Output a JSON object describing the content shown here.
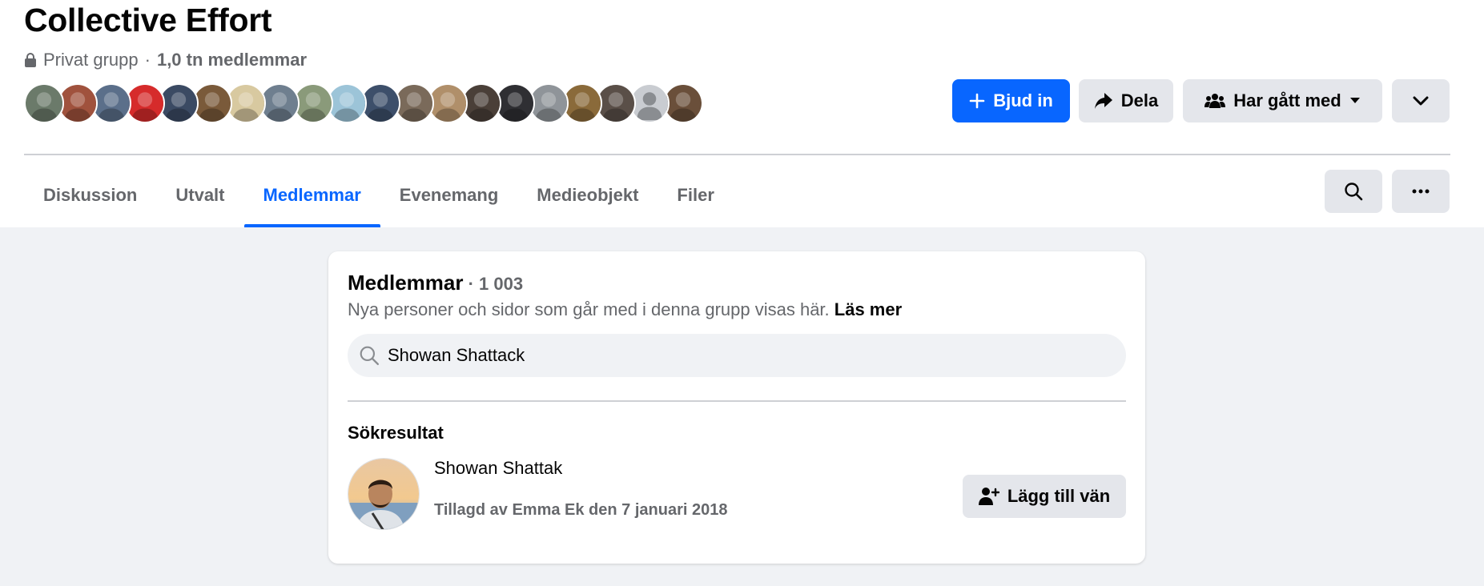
{
  "group": {
    "title": "Collective Effort",
    "privacy": "Privat grupp",
    "separator": "·",
    "members_summary": "1,0 tn medlemmar"
  },
  "avatars": [
    {
      "color": "#6b7a6a"
    },
    {
      "color": "#a0523d"
    },
    {
      "color": "#5b6f8a"
    },
    {
      "color": "#d62b2b"
    },
    {
      "color": "#3b4a63"
    },
    {
      "color": "#7a5a3a"
    },
    {
      "color": "#d8c9a0"
    },
    {
      "color": "#6f7f8f"
    },
    {
      "color": "#8a9a7a"
    },
    {
      "color": "#9cc4d8"
    },
    {
      "color": "#3d4f6a"
    },
    {
      "color": "#7a6a5a"
    },
    {
      "color": "#b08f6a"
    },
    {
      "color": "#4a3f38"
    },
    {
      "color": "#2f2f33"
    },
    {
      "color": "#8f9499"
    },
    {
      "color": "#8a6a3a"
    },
    {
      "color": "#5a4f48"
    },
    {
      "color": "#c9ccd1"
    },
    {
      "color": "#6a4f3a"
    }
  ],
  "actions": {
    "invite_label": "Bjud in",
    "share_label": "Dela",
    "joined_label": "Har gått med"
  },
  "tabs": [
    {
      "label": "Diskussion",
      "active": false
    },
    {
      "label": "Utvalt",
      "active": false
    },
    {
      "label": "Medlemmar",
      "active": true
    },
    {
      "label": "Evenemang",
      "active": false
    },
    {
      "label": "Medieobjekt",
      "active": false
    },
    {
      "label": "Filer",
      "active": false
    }
  ],
  "members_card": {
    "title": "Medlemmar",
    "count": " · 1 003",
    "subtitle": "Nya personer och sidor som går med i denna grupp visas här.",
    "read_more": "Läs mer",
    "search_value": "Showan Shattack",
    "results_heading": "Sökresultat",
    "result": {
      "name": "Showan Shattak",
      "meta": "Tillagd av Emma Ek den 7 januari 2018",
      "add_friend_label": "Lägg till vän"
    }
  },
  "colors": {
    "accent": "#0866ff",
    "secondary_button": "#e4e6eb",
    "muted_text": "#65676b",
    "page_background": "#f0f2f5"
  }
}
